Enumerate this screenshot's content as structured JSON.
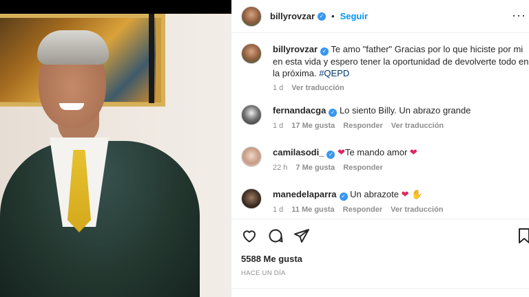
{
  "post": {
    "username": "billyrovzar",
    "follow_label": "Seguir",
    "separator": "•",
    "more_label": "···"
  },
  "caption": {
    "username": "billyrovzar",
    "text": "Te amo \"father\" Gracias por lo que hiciste por mi en esta vida y espero tener la oportunidad de devolverte todo en la próxima.",
    "hashtag": "#QEPD",
    "time": "1 d",
    "translate": "Ver traducción"
  },
  "comments": [
    {
      "username": "fernandacga",
      "text": "Lo siento Billy. Un abrazo grande",
      "time": "1 d",
      "likes": "17 Me gusta",
      "reply": "Responder",
      "translate": "Ver traducción"
    },
    {
      "username": "camilasodi_",
      "text": "Te mando amor",
      "time": "22 h",
      "likes": "7 Me gusta",
      "reply": "Responder"
    },
    {
      "username": "manedelaparra",
      "text": "Un abrazote",
      "time": "1 d",
      "likes": "11 Me gusta",
      "reply": "Responder",
      "translate": "Ver traducción"
    }
  ],
  "footer": {
    "likes": "5588 Me gusta",
    "ago": "HACE UN DÍA"
  },
  "colors": {
    "accent": "#0095f6",
    "verified": "#3897f0",
    "muted": "#8e8e8e",
    "heart": "#e0245e"
  },
  "icons": [
    "heart-icon",
    "comment-icon",
    "share-icon",
    "bookmark-icon",
    "verified-icon",
    "heart-emoji-icon",
    "praying-hands-emoji-icon"
  ]
}
